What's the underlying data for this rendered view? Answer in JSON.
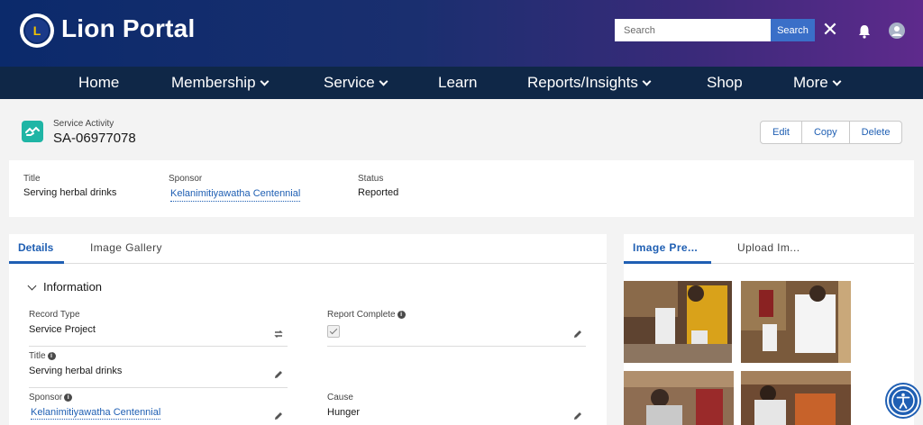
{
  "header": {
    "brand": "Lion Portal",
    "search_placeholder": "Search",
    "search_button": "Search"
  },
  "nav": {
    "items": [
      {
        "label": "Home",
        "has_menu": false
      },
      {
        "label": "Membership",
        "has_menu": true
      },
      {
        "label": "Service",
        "has_menu": true
      },
      {
        "label": "Learn",
        "has_menu": false
      },
      {
        "label": "Reports/Insights",
        "has_menu": true
      },
      {
        "label": "Shop",
        "has_menu": false
      },
      {
        "label": "More",
        "has_menu": true
      }
    ]
  },
  "record": {
    "type": "Service Activity",
    "name": "SA-06977078",
    "actions": [
      "Edit",
      "Copy",
      "Delete"
    ]
  },
  "highlights": {
    "title_label": "Title",
    "title_value": "Serving herbal drinks",
    "sponsor_label": "Sponsor",
    "sponsor_value": "Kelanimitiyawatha Centennial",
    "status_label": "Status",
    "status_value": "Reported"
  },
  "details_tabs": [
    "Details",
    "Image Gallery"
  ],
  "section": {
    "title": "Information",
    "record_type_label": "Record Type",
    "record_type_value": "Service Project",
    "report_complete_label": "Report Complete",
    "report_complete_checked": true,
    "title_label": "Title",
    "title_value": "Serving herbal drinks",
    "sponsor_label": "Sponsor",
    "sponsor_value": "Kelanimitiyawatha Centennial",
    "cause_label": "Cause",
    "cause_value": "Hunger"
  },
  "image_tabs": [
    "Image Pre...",
    "Upload Im..."
  ],
  "colors": {
    "accent": "#1f5fb3",
    "header_start": "#0b2a6b",
    "header_end": "#5e2a8c",
    "nav_bg": "#0f2747",
    "record_icon": "#1fb5a5"
  }
}
